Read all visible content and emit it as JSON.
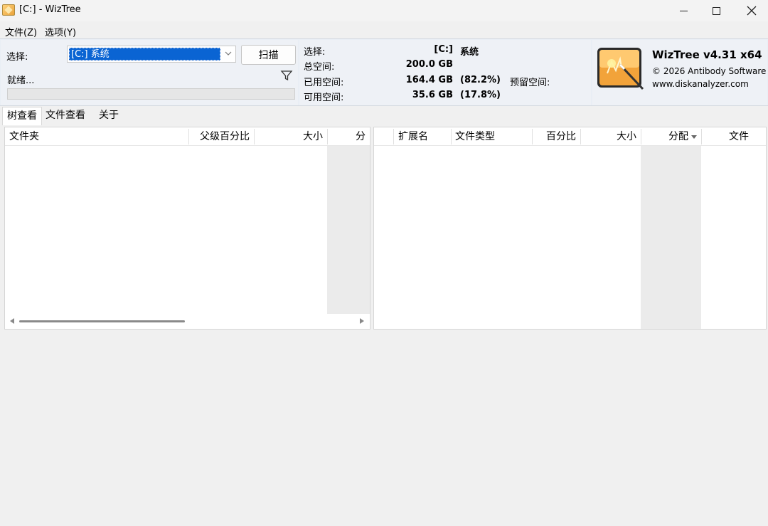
{
  "window": {
    "title": "[C:]  - WizTree"
  },
  "menu": {
    "file": "文件(Z)",
    "options": "选项(Y)"
  },
  "controls": {
    "select_label": "选择:",
    "drive_value": "[C:] 系统",
    "scan_label": "扫描",
    "status": "就绪...",
    "progress": 0
  },
  "info": {
    "select_key": "选择:",
    "select_drive": "[C:]",
    "select_name": "系统",
    "total_key": "总空间:",
    "total_value": "200.0 GB",
    "used_key": "已用空间:",
    "used_value": "164.4 GB",
    "used_pct": "(82.2%)",
    "reserved_key": "预留空间:",
    "free_key": "可用空间:",
    "free_value": "35.6 GB",
    "free_pct": "(17.8%)"
  },
  "logo": {
    "title": "WizTree v4.31 x64",
    "copyright": "© 2026 Antibody Software",
    "url": "www.diskanalyzer.com"
  },
  "tabs": [
    "树查看",
    "文件查看",
    "关于"
  ],
  "tree_columns": [
    "文件夹",
    "父级百分比",
    "大小",
    "分"
  ],
  "ext_columns": [
    "扩展名",
    "文件类型",
    "百分比",
    "大小",
    "分配",
    "文件"
  ],
  "icons": {
    "app": "wiztree-logo-icon",
    "filter": "filter-icon",
    "dropdown": "chevron-down-icon",
    "sort": "sort-desc-icon"
  }
}
